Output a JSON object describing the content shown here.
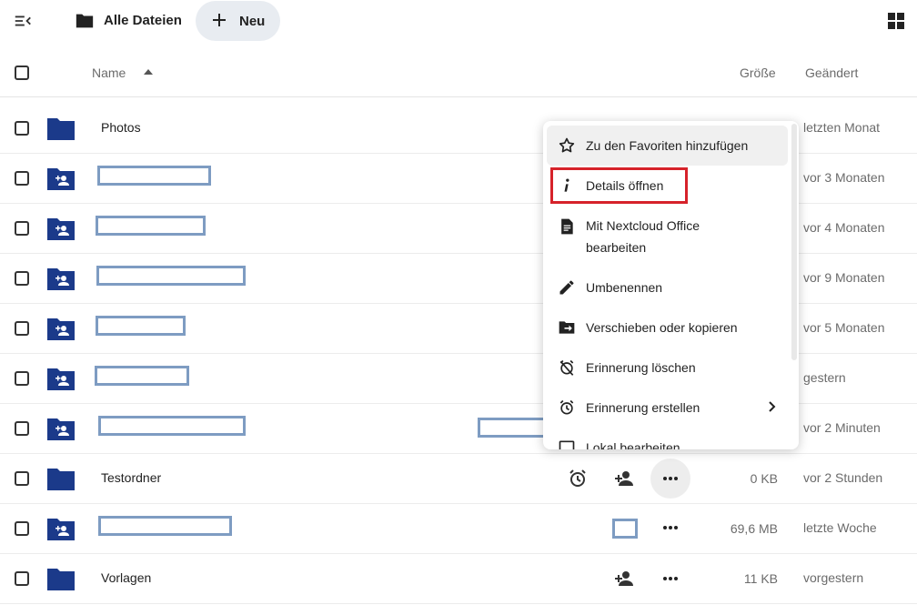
{
  "header": {
    "breadcrumb": "Alle Dateien",
    "new_label": "Neu"
  },
  "columns": {
    "name": "Name",
    "size": "Größe",
    "modified": "Geändert"
  },
  "rows": [
    {
      "name": "Photos",
      "size": "",
      "modified": "letzten Monat"
    },
    {
      "name": "",
      "size": "",
      "modified": "vor 3 Monaten"
    },
    {
      "name": "",
      "size": "",
      "modified": "vor 4 Monaten"
    },
    {
      "name": "",
      "size": "",
      "modified": "vor 9 Monaten"
    },
    {
      "name": "",
      "size": "",
      "modified": "vor 5 Monaten"
    },
    {
      "name": "",
      "size": "",
      "modified": "gestern"
    },
    {
      "name": "",
      "size": "",
      "modified": "vor 2 Minuten"
    },
    {
      "name": "Testordner",
      "size": "0 KB",
      "modified": "vor 2 Stunden"
    },
    {
      "name": "",
      "size": "69,6 MB",
      "modified": "letzte Woche"
    },
    {
      "name": "Vorlagen",
      "size": "11 KB",
      "modified": "vorgestern"
    }
  ],
  "context_menu": {
    "items": [
      {
        "label": "Zu den Favoriten hinzufügen",
        "icon": "star-outline-icon"
      },
      {
        "label": "Details öffnen",
        "icon": "info-icon"
      },
      {
        "label": "Mit Nextcloud Office",
        "label2": "bearbeiten",
        "icon": "document-icon"
      },
      {
        "label": "Umbenennen",
        "icon": "pencil-icon"
      },
      {
        "label": "Verschieben oder kopieren",
        "icon": "folder-move-icon"
      },
      {
        "label": "Erinnerung löschen",
        "icon": "alarm-off-icon"
      },
      {
        "label": "Erinnerung erstellen",
        "icon": "alarm-icon"
      },
      {
        "label": "Lokal bearbeiten",
        "icon": "laptop-icon"
      }
    ]
  },
  "colors": {
    "folder": "#1b3a8a",
    "highlight": "#d6222a",
    "redaction": "#7e9cc2"
  }
}
